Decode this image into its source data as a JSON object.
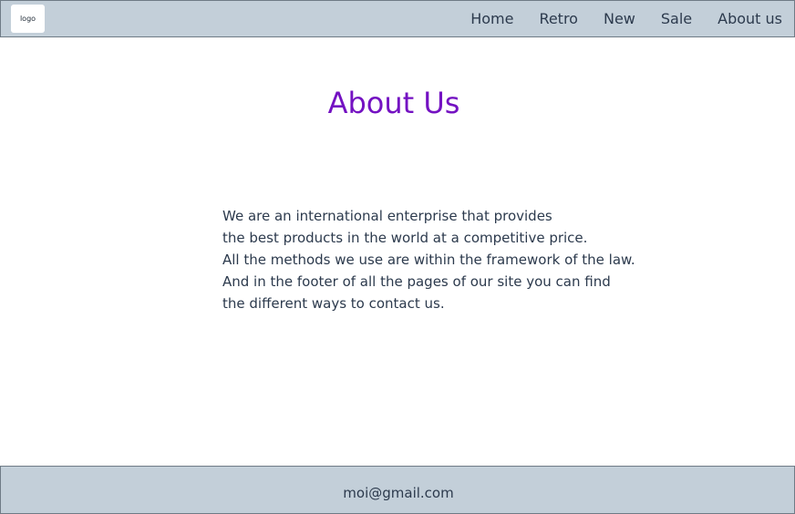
{
  "header": {
    "logo_text": "logo",
    "nav": [
      {
        "label": "Home"
      },
      {
        "label": "Retro"
      },
      {
        "label": "New"
      },
      {
        "label": "Sale"
      },
      {
        "label": "About us"
      }
    ]
  },
  "main": {
    "title": "About Us",
    "paragraph_lines": [
      "We are an international enterprise that provides",
      "the best products in the world at a competitive price.",
      "All the methods we use are within the framework of the law.",
      "And in the footer of all the pages of our site you can find",
      "the different ways to contact us."
    ]
  },
  "footer": {
    "email": "moi@gmail.com"
  },
  "colors": {
    "header_bg": "#c3cfd9",
    "title": "#7412c2",
    "text": "#2c3a4d"
  }
}
